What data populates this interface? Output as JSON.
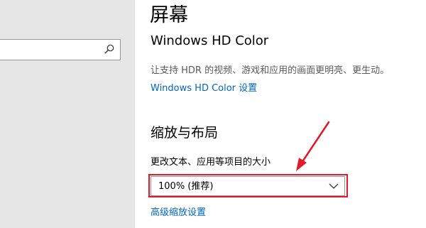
{
  "sidebar": {
    "search": {
      "value": "",
      "placeholder": ""
    }
  },
  "main": {
    "title": "屏幕",
    "hdr": {
      "heading": "Windows HD Color",
      "description": "让支持 HDR 的视频、游戏和应用的画面更明亮、更生动。",
      "settings_link": "Windows HD Color 设置"
    },
    "scale_layout": {
      "heading": "缩放与布局",
      "text_size_label": "更改文本、应用等项目的大小",
      "text_size_selected": "100% (推荐)",
      "advanced_link": "高级缩放设置"
    }
  },
  "annotation": {
    "color": "#e0192b"
  },
  "theme": {
    "link_color": "#0067c0",
    "sidebar_bg": "#e6e6e6"
  }
}
